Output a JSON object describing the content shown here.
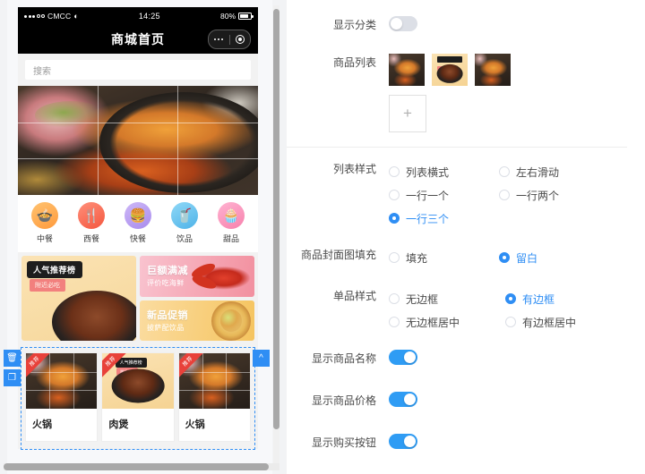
{
  "preview": {
    "statusbar": {
      "carrier": "CMCC",
      "wifi_icon": "wifi-icon",
      "time": "14:25",
      "battery": "80%"
    },
    "navbar": {
      "title": "商城首页",
      "more_icon": "more-dots-icon",
      "target_icon": "target-circle-icon"
    },
    "search": {
      "placeholder": "搜索"
    },
    "hero": {
      "name": "hotpot-banner-image"
    },
    "categories": [
      {
        "label": "中餐",
        "glyph": "🍲",
        "icon": "chinese-food-icon"
      },
      {
        "label": "西餐",
        "glyph": "🍴",
        "icon": "western-food-icon"
      },
      {
        "label": "快餐",
        "glyph": "🍔",
        "icon": "fast-food-icon"
      },
      {
        "label": "饮品",
        "glyph": "🥤",
        "icon": "drinks-icon"
      },
      {
        "label": "甜品",
        "glyph": "🧁",
        "icon": "dessert-icon"
      }
    ],
    "banners": {
      "left": {
        "tag": "人气推荐榜",
        "sub": "附近必吃"
      },
      "top_right": {
        "title": "巨额满减",
        "subtitle": "评价吃海鲜"
      },
      "bottom_right": {
        "title": "新品促销",
        "subtitle": "披萨配饮品"
      }
    },
    "products": [
      {
        "name": "火锅",
        "badge": "推荐",
        "style": "hot"
      },
      {
        "name": "肉煲",
        "badge": "推荐",
        "style": "rou"
      },
      {
        "name": "火锅",
        "badge": "推荐",
        "style": "hot"
      }
    ],
    "tools": {
      "delete_icon": "trash-icon",
      "copy_icon": "copy-icon",
      "up_icon": "chevron-up-icon"
    }
  },
  "settings": {
    "show_category": {
      "label": "显示分类",
      "on": false
    },
    "product_list": {
      "label": "商品列表",
      "add_label": "+"
    },
    "list_style": {
      "label": "列表样式",
      "options": [
        {
          "label": "列表横式",
          "selected": false
        },
        {
          "label": "左右滑动",
          "selected": false
        },
        {
          "label": "一行一个",
          "selected": false
        },
        {
          "label": "一行两个",
          "selected": false
        },
        {
          "label": "一行三个",
          "selected": true
        }
      ]
    },
    "cover_fill": {
      "label": "商品封面图填充",
      "options": [
        {
          "label": "填充",
          "selected": false
        },
        {
          "label": "留白",
          "selected": true
        }
      ]
    },
    "item_style": {
      "label": "单品样式",
      "options": [
        {
          "label": "无边框",
          "selected": false
        },
        {
          "label": "有边框",
          "selected": true
        },
        {
          "label": "无边框居中",
          "selected": false
        },
        {
          "label": "有边框居中",
          "selected": false
        }
      ]
    },
    "show_name": {
      "label": "显示商品名称",
      "on": true
    },
    "show_price": {
      "label": "显示商品价格",
      "on": true
    },
    "show_buy_button": {
      "label": "显示购买按钮",
      "on": true
    }
  },
  "colors": {
    "accent": "#2f8ef4",
    "switch_on": "#2f9cf4",
    "switch_off": "#dcdfe6"
  }
}
